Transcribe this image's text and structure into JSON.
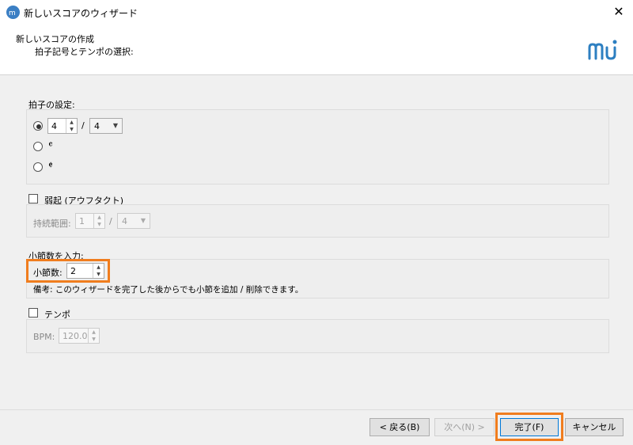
{
  "window": {
    "title": "新しいスコアのウィザード",
    "close_symbol": "✕"
  },
  "header": {
    "title": "新しいスコアの作成",
    "subtitle": "拍子記号とテンポの選択:"
  },
  "time_signature": {
    "label": "拍子の設定:",
    "numerator": "4",
    "separator": "/",
    "denominator": "4",
    "common_time_symbol": "𝄴",
    "cut_time_symbol": "𝄵"
  },
  "pickup": {
    "label": "弱起 (アウフタクト)",
    "duration_label": "持続範囲:",
    "numerator": "1",
    "separator": "/",
    "denominator": "4"
  },
  "measures": {
    "label": "小節数を入力:",
    "count_label": "小節数:",
    "count": "2",
    "note": "備考: このウィザードを完了した後からでも小節を追加 / 削除できます。"
  },
  "tempo": {
    "label": "テンポ",
    "bpm_label": "BPM:",
    "bpm": "120.0"
  },
  "footer": {
    "back": "< 戻る(B)",
    "next": "次へ(N) >",
    "finish": "完了(F)",
    "cancel": "キャンセル"
  },
  "colors": {
    "highlight": "#f07d1e",
    "app_icon": "#3b7fc4",
    "logo": "#2d7fc1"
  }
}
